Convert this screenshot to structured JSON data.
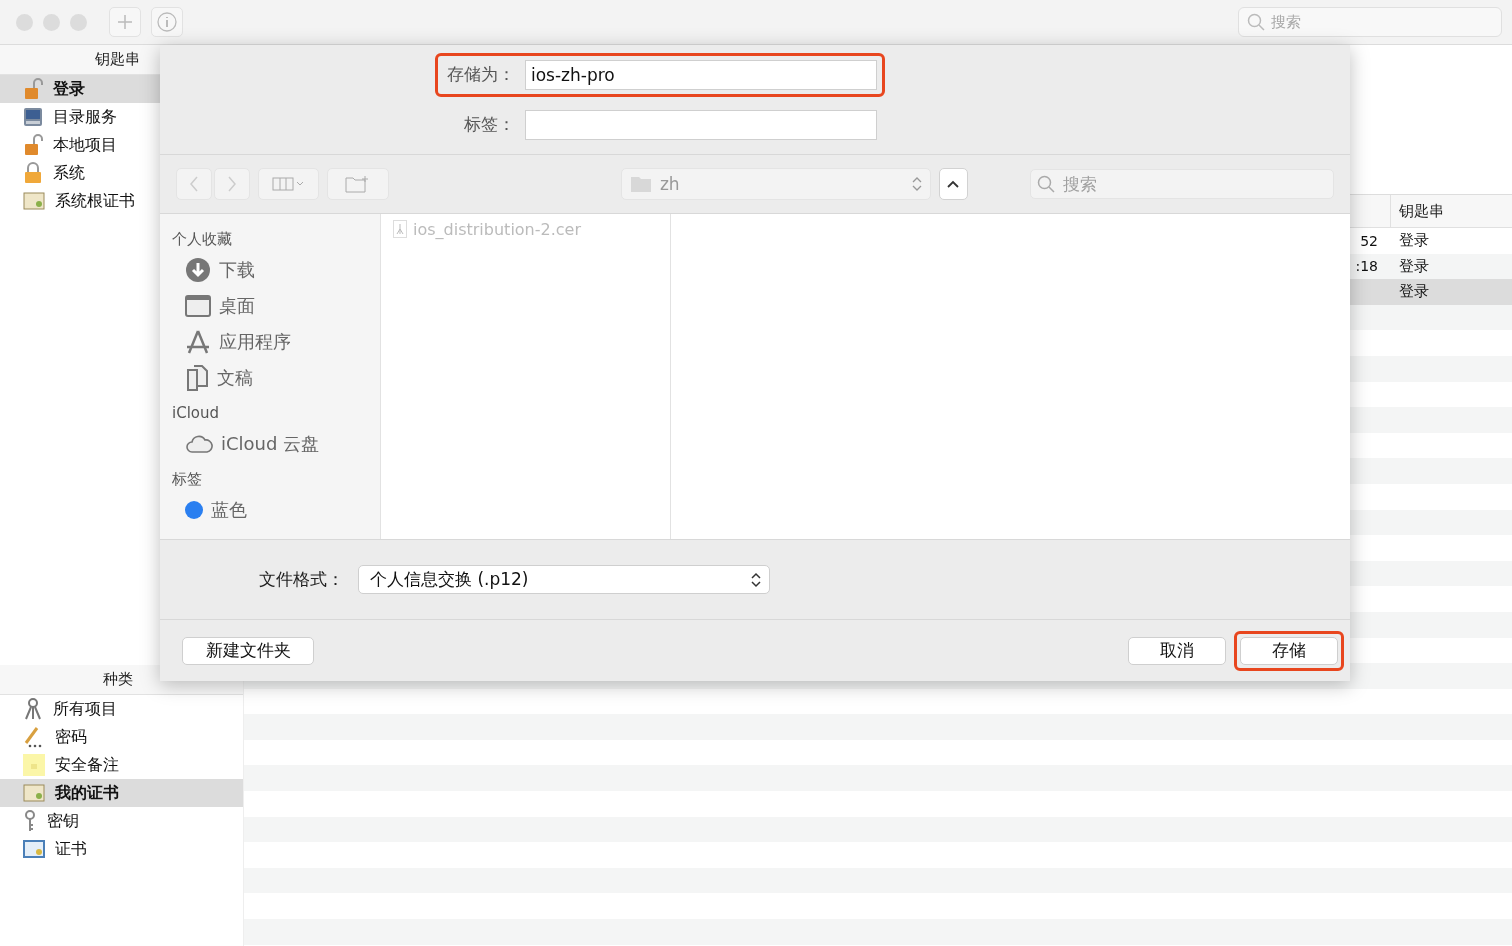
{
  "toolbar": {
    "search": {
      "placeholder": "搜索"
    }
  },
  "keychains": {
    "title": "钥匙串",
    "items": [
      {
        "label": "登录",
        "kind": "lock-open",
        "selected": true
      },
      {
        "label": "目录服务",
        "kind": "directory",
        "selected": false
      },
      {
        "label": "本地项目",
        "kind": "lock-open",
        "selected": false
      },
      {
        "label": "系统",
        "kind": "lock",
        "selected": false
      },
      {
        "label": "系统根证书",
        "kind": "certificate",
        "selected": false
      }
    ]
  },
  "categories": {
    "title": "种类",
    "items": [
      {
        "label": "所有项目",
        "kind": "keys",
        "selected": false
      },
      {
        "label": "密码",
        "kind": "pencil",
        "selected": false
      },
      {
        "label": "安全备注",
        "kind": "note",
        "selected": false
      },
      {
        "label": "我的证书",
        "kind": "certificate",
        "selected": true
      },
      {
        "label": "密钥",
        "kind": "key",
        "selected": false
      },
      {
        "label": "证书",
        "kind": "certificate-blue",
        "selected": false
      }
    ]
  },
  "table": {
    "columns": [
      "钥匙串"
    ],
    "rows": [
      {
        "column_1": "52",
        "keychain": "登录",
        "selected": false
      },
      {
        "column_1": ":18",
        "keychain": "登录",
        "selected": false
      },
      {
        "keychain": "登录",
        "selected": true
      }
    ]
  },
  "dialog": {
    "save_as": {
      "label": "存储为：",
      "value": "ios-zh-pro",
      "highlighted": true
    },
    "tags": {
      "label": "标签：",
      "highlighted": false
    },
    "location": "zh",
    "search": {
      "placeholder": "搜索"
    },
    "sidebar": [
      {
        "title": "个人收藏",
        "items": [
          {
            "label": "下载",
            "kind": "download"
          },
          {
            "label": "桌面",
            "kind": "desktop"
          },
          {
            "label": "应用程序",
            "kind": "apps"
          },
          {
            "label": "文稿",
            "kind": "document"
          }
        ]
      },
      {
        "title": "iCloud",
        "items": [
          {
            "label": "iCloud 云盘",
            "kind": "cloud"
          }
        ]
      },
      {
        "title": "标签",
        "items": [
          {
            "label": "蓝色",
            "kind": "tag",
            "color": "#2a7ff0"
          }
        ]
      }
    ],
    "files": [
      {
        "name": "ios_distribution-2.cer",
        "disabled": true
      }
    ],
    "format": {
      "label": "文件格式：",
      "value": "个人信息交换 (.p12)"
    },
    "new_folder": "新建文件夹",
    "buttons": [
      {
        "label": "取消",
        "highlighted": false
      },
      {
        "label": "存储",
        "highlighted": true
      }
    ]
  }
}
